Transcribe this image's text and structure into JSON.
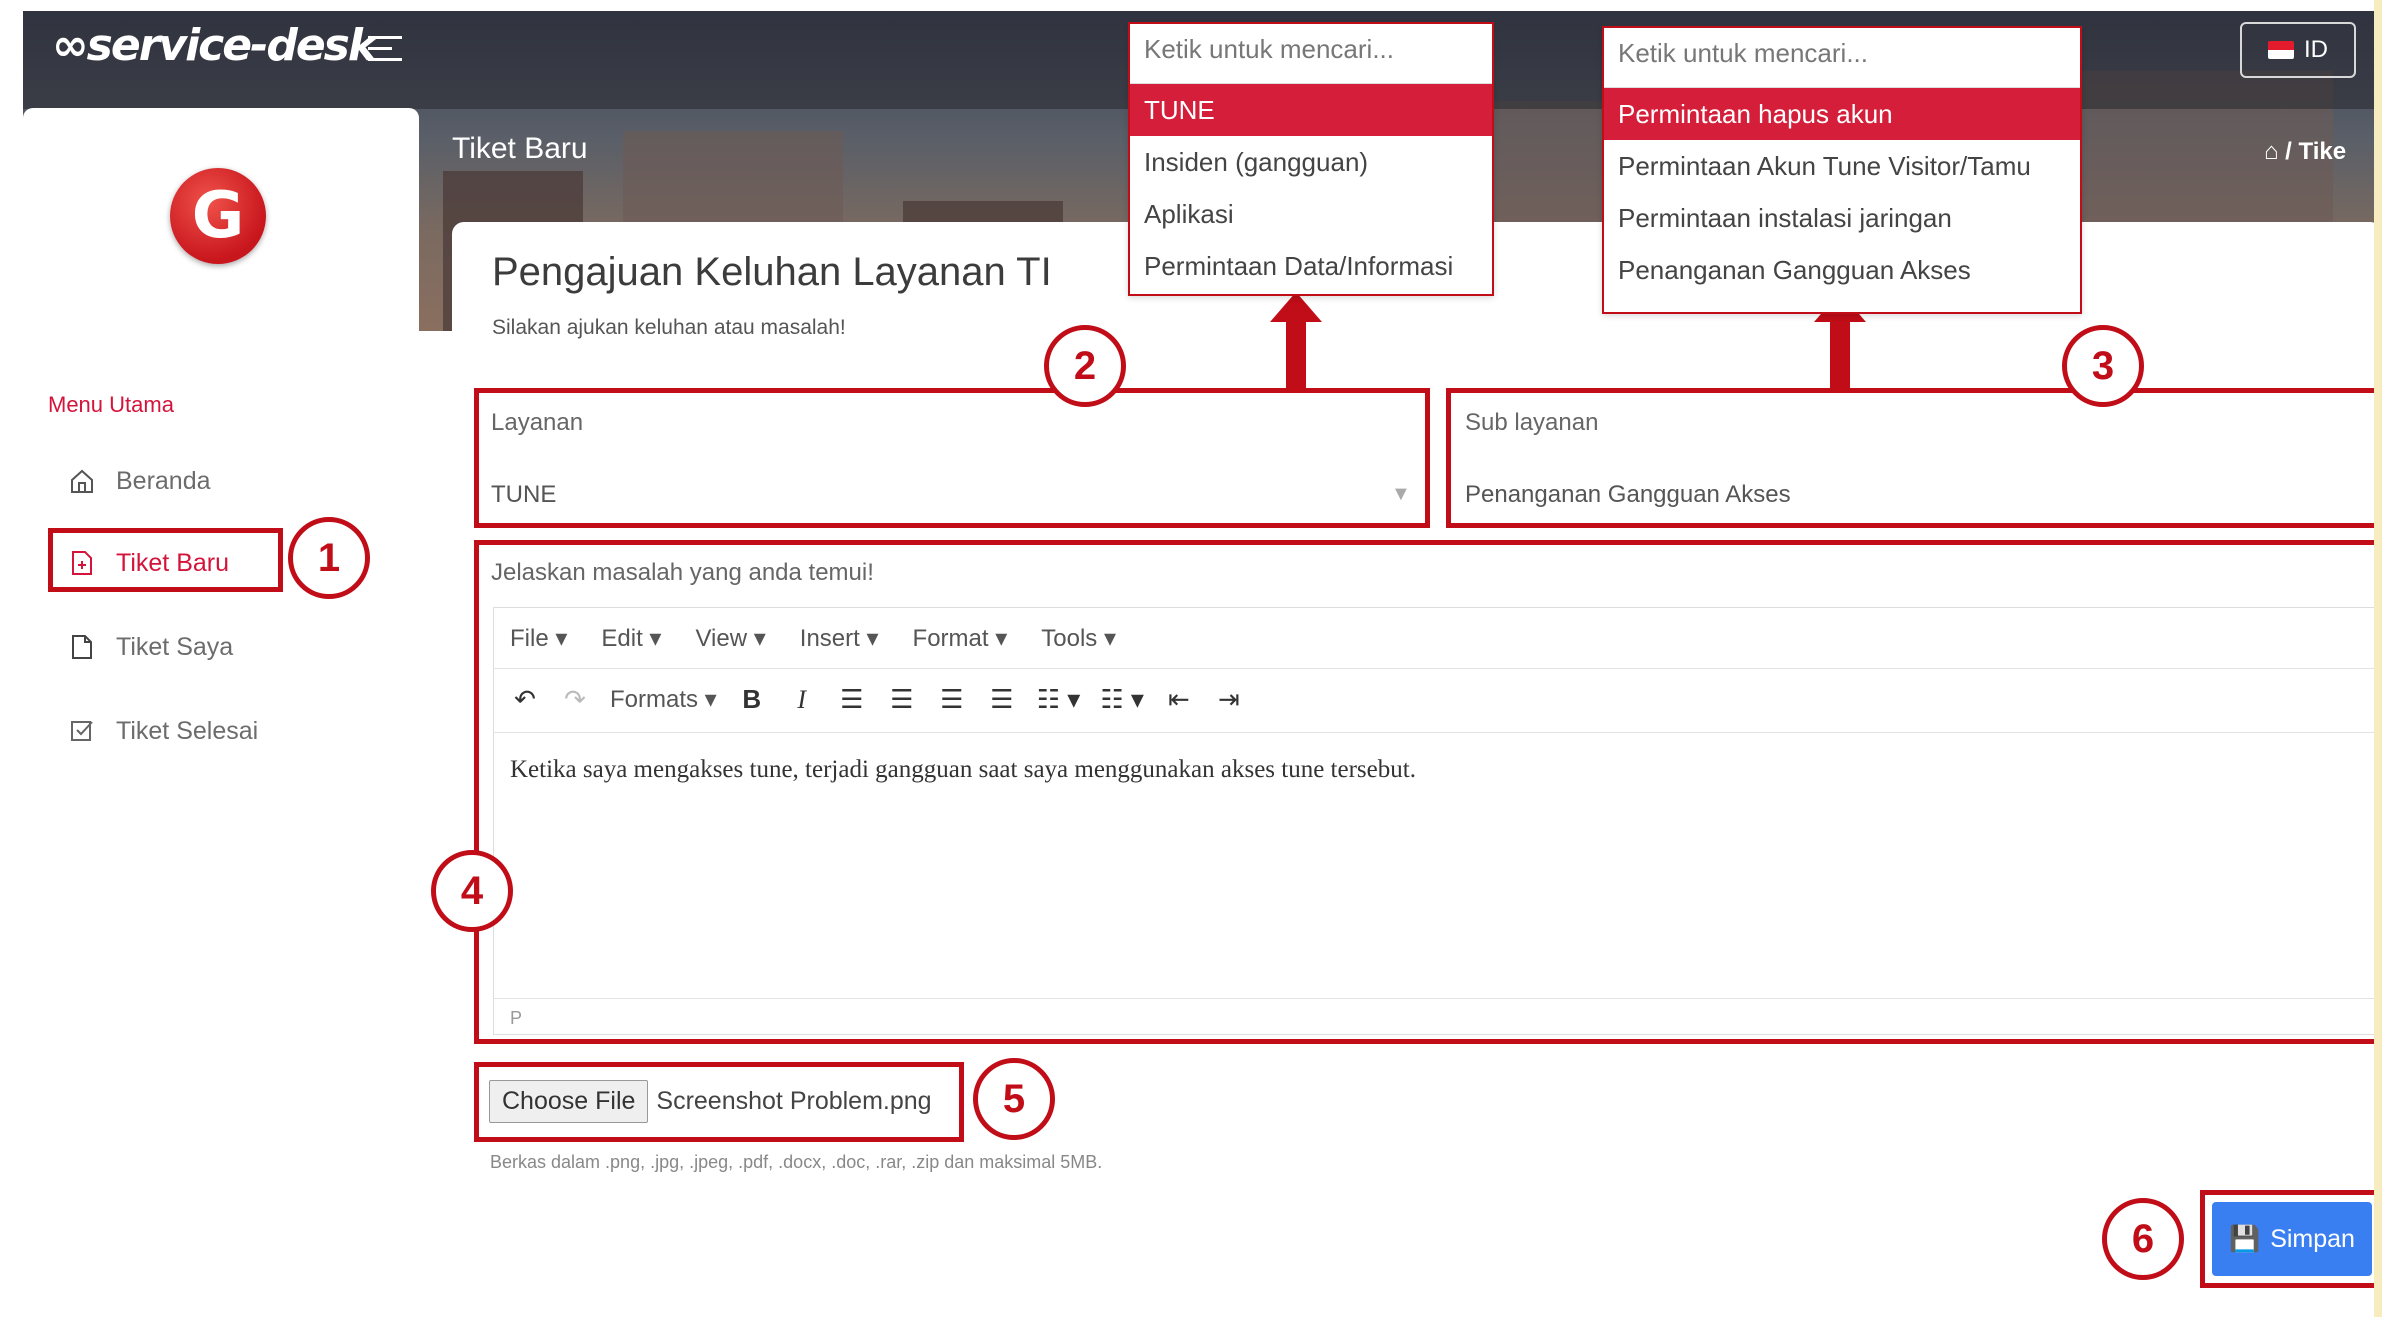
{
  "app": {
    "logo_text": "service-desk",
    "language": "ID"
  },
  "header": {
    "page_title": "Tiket Baru",
    "breadcrumb": "⌂  /  Tike"
  },
  "sidebar": {
    "section_label": "Menu Utama",
    "items": [
      {
        "label": "Beranda",
        "icon": "home-icon"
      },
      {
        "label": "Tiket Baru",
        "icon": "new-file-icon"
      },
      {
        "label": "Tiket Saya",
        "icon": "file-icon"
      },
      {
        "label": "Tiket Selesai",
        "icon": "checked-box-icon"
      }
    ]
  },
  "form": {
    "title": "Pengajuan Keluhan Layanan TI",
    "subtitle": "Silakan ajukan keluhan atau masalah!",
    "layanan": {
      "label": "Layanan",
      "value": "TUNE"
    },
    "sub_layanan": {
      "label": "Sub layanan",
      "value": "Penanganan Gangguan Akses"
    },
    "description": {
      "label": "Jelaskan masalah yang anda temui!",
      "menubar": [
        "File",
        "Edit",
        "View",
        "Insert",
        "Format",
        "Tools"
      ],
      "formats_label": "Formats",
      "content": "Ketika saya mengakses tune, terjadi gangguan saat saya menggunakan akses tune tersebut.",
      "status_path": "P"
    },
    "file": {
      "button_label": "Choose File",
      "file_name": "Screenshot Problem.png",
      "hint": "Berkas dalam .png, .jpg, .jpeg, .pdf, .docx, .doc, .rar, .zip dan maksimal 5MB."
    },
    "save_label": "Simpan"
  },
  "dropdown_layanan": {
    "search_placeholder": "Ketik untuk mencari...",
    "options": [
      "TUNE",
      "Insiden (gangguan)",
      "Aplikasi",
      "Permintaan Data/Informasi"
    ],
    "highlighted": "TUNE"
  },
  "dropdown_sub_layanan": {
    "search_placeholder": "Ketik untuk mencari...",
    "options": [
      "Permintaan hapus akun",
      "Permintaan Akun Tune Visitor/Tamu",
      "Permintaan instalasi jaringan",
      "Penanganan Gangguan Akses"
    ],
    "highlighted": "Permintaan hapus akun"
  },
  "callouts": [
    "1",
    "2",
    "3",
    "4",
    "5",
    "6"
  ],
  "colors": {
    "accent": "#d4143a",
    "annotation": "#c00d18",
    "save": "#3a7ff2"
  }
}
